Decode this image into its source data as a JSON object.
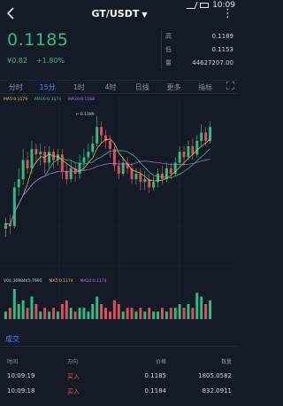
{
  "status": {
    "time": "10:09"
  },
  "header": {
    "pair": "GT/USDT",
    "caret": "▼",
    "more": "⋮"
  },
  "price": {
    "last": "0.1185",
    "cny": "¥0.82",
    "change": "+1.80%"
  },
  "stats": [
    {
      "label": "高",
      "value": "0.1189"
    },
    {
      "label": "低",
      "value": "0.1153"
    },
    {
      "label": "量",
      "value": "44627207.00"
    }
  ],
  "periods": {
    "items": [
      "分时",
      "15分",
      "1时",
      "4时",
      "日线",
      "更多",
      "指标"
    ],
    "active": 1
  },
  "ma_legend": {
    "ma5": "MA5:0.1179",
    "ma10": "MA10:0.1174",
    "ma30": "MA30:0.1168"
  },
  "vol_legend": {
    "vol": "VOL:3698445.7995",
    "ma5": "MA5:0.1174",
    "ma10": "MA10:0.1174"
  },
  "chart_data": {
    "type": "candlestick",
    "high_label": "0.1189",
    "candles": [
      [
        0.1148,
        0.115,
        0.1145,
        0.1152
      ],
      [
        0.115,
        0.1149,
        0.1146,
        0.1153
      ],
      [
        0.1149,
        0.1163,
        0.1148,
        0.1165
      ],
      [
        0.1163,
        0.1166,
        0.116,
        0.117
      ],
      [
        0.1166,
        0.1173,
        0.1164,
        0.1177
      ],
      [
        0.1173,
        0.117,
        0.1168,
        0.1176
      ],
      [
        0.117,
        0.1177,
        0.1168,
        0.118
      ],
      [
        0.1177,
        0.1175,
        0.1172,
        0.1179
      ],
      [
        0.1175,
        0.1176,
        0.1171,
        0.1179
      ],
      [
        0.1176,
        0.1172,
        0.1168,
        0.1178
      ],
      [
        0.1172,
        0.1176,
        0.117,
        0.1178
      ],
      [
        0.1176,
        0.1173,
        0.117,
        0.1177
      ],
      [
        0.1173,
        0.1175,
        0.1171,
        0.1177
      ],
      [
        0.1175,
        0.1169,
        0.1166,
        0.1177
      ],
      [
        0.1169,
        0.1166,
        0.1164,
        0.1172
      ],
      [
        0.1166,
        0.117,
        0.1165,
        0.1173
      ],
      [
        0.117,
        0.1168,
        0.1165,
        0.1172
      ],
      [
        0.1168,
        0.1172,
        0.1166,
        0.1175
      ],
      [
        0.1172,
        0.1174,
        0.1169,
        0.1177
      ],
      [
        0.1174,
        0.1176,
        0.1172,
        0.1179
      ],
      [
        0.1176,
        0.1179,
        0.1175,
        0.1182
      ],
      [
        0.1179,
        0.1185,
        0.1178,
        0.1189
      ],
      [
        0.1185,
        0.1182,
        0.1179,
        0.1187
      ],
      [
        0.1182,
        0.118,
        0.1177,
        0.1184
      ],
      [
        0.118,
        0.1177,
        0.1174,
        0.1182
      ],
      [
        0.1177,
        0.1171,
        0.1169,
        0.1179
      ],
      [
        0.1171,
        0.1168,
        0.1166,
        0.1173
      ],
      [
        0.1168,
        0.1172,
        0.1167,
        0.1174
      ],
      [
        0.1172,
        0.117,
        0.1168,
        0.1174
      ],
      [
        0.117,
        0.1166,
        0.1164,
        0.1172
      ],
      [
        0.1166,
        0.1168,
        0.1164,
        0.117
      ],
      [
        0.1168,
        0.1165,
        0.1162,
        0.117
      ],
      [
        0.1165,
        0.1166,
        0.1162,
        0.1169
      ],
      [
        0.1166,
        0.1163,
        0.1161,
        0.1168
      ],
      [
        0.1163,
        0.1165,
        0.1162,
        0.1167
      ],
      [
        0.1165,
        0.1168,
        0.1163,
        0.117
      ],
      [
        0.1168,
        0.1166,
        0.1164,
        0.1171
      ],
      [
        0.1166,
        0.117,
        0.1165,
        0.1172
      ],
      [
        0.117,
        0.1168,
        0.1166,
        0.1172
      ],
      [
        0.1168,
        0.1172,
        0.1167,
        0.1174
      ],
      [
        0.1172,
        0.1176,
        0.1171,
        0.1178
      ],
      [
        0.1176,
        0.1174,
        0.1171,
        0.1178
      ],
      [
        0.1174,
        0.1178,
        0.1173,
        0.118
      ],
      [
        0.1178,
        0.1175,
        0.1173,
        0.1181
      ],
      [
        0.1175,
        0.118,
        0.1174,
        0.1182
      ],
      [
        0.118,
        0.1183,
        0.1178,
        0.1186
      ],
      [
        0.1183,
        0.118,
        0.1178,
        0.1185
      ],
      [
        0.118,
        0.1185,
        0.1179,
        0.1187
      ]
    ],
    "volumes": [
      2,
      3,
      8,
      4,
      5,
      3,
      6,
      4,
      2,
      3,
      2,
      3,
      2,
      4,
      5,
      3,
      2,
      3,
      3,
      2,
      4,
      6,
      4,
      3,
      2,
      5,
      4,
      2,
      3,
      3,
      2,
      3,
      2,
      3,
      2,
      2,
      3,
      2,
      3,
      3,
      4,
      3,
      4,
      3,
      7,
      6,
      4,
      5
    ]
  },
  "trades": {
    "title": "成交",
    "headers": {
      "time": "时间",
      "dir": "方向",
      "price": "价格",
      "amount": "数量"
    },
    "rows": [
      {
        "time": "10:09:19",
        "dir": "买入",
        "price": "0.1185",
        "amount": "1805.0582"
      },
      {
        "time": "10:09:18",
        "dir": "买入",
        "price": "0.1184",
        "amount": "832.0911"
      }
    ]
  },
  "colors": {
    "up": "#2fbd85",
    "down": "#e0505a",
    "accent": "#3d8bff",
    "bg": "#141a26"
  }
}
